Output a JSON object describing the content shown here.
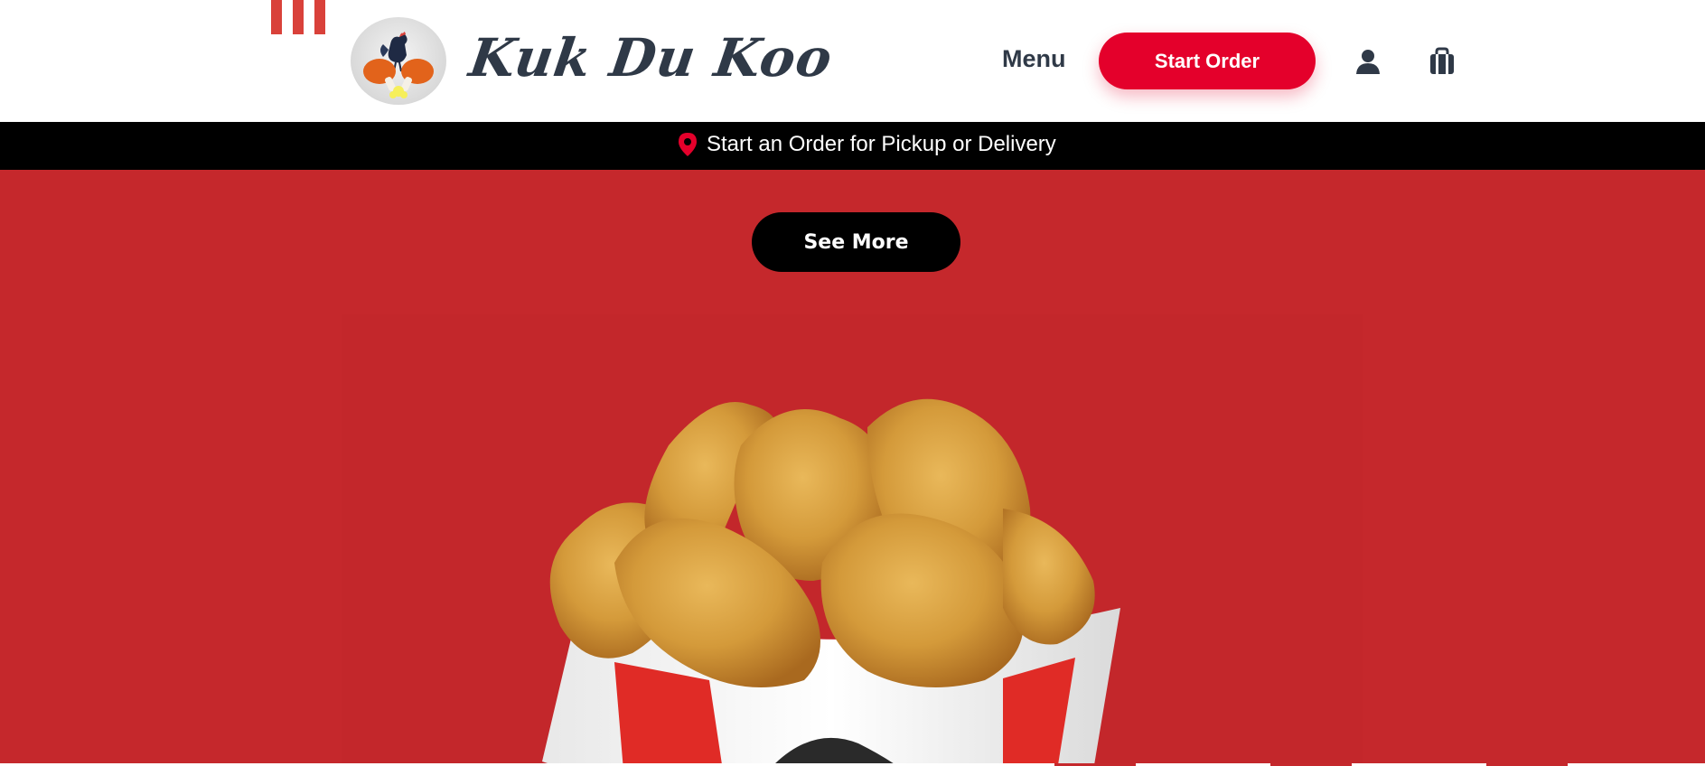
{
  "header": {
    "brand_name": "Kuk Du Koo",
    "nav_menu_label": "Menu",
    "start_order_label": "Start Order",
    "account_icon": "user-icon",
    "cart_icon": "shopping-bag-icon"
  },
  "banner": {
    "icon": "location-pin-icon",
    "text": "Start an Order for Pickup or Delivery"
  },
  "hero": {
    "see_more_label": "See More",
    "image": "fried-chicken-bucket"
  },
  "colors": {
    "brand_red": "#e4002b",
    "hero_red": "#c5282c",
    "stripe_red": "#d9413a",
    "dark_text": "#2f3947",
    "banner_black": "#000000"
  }
}
